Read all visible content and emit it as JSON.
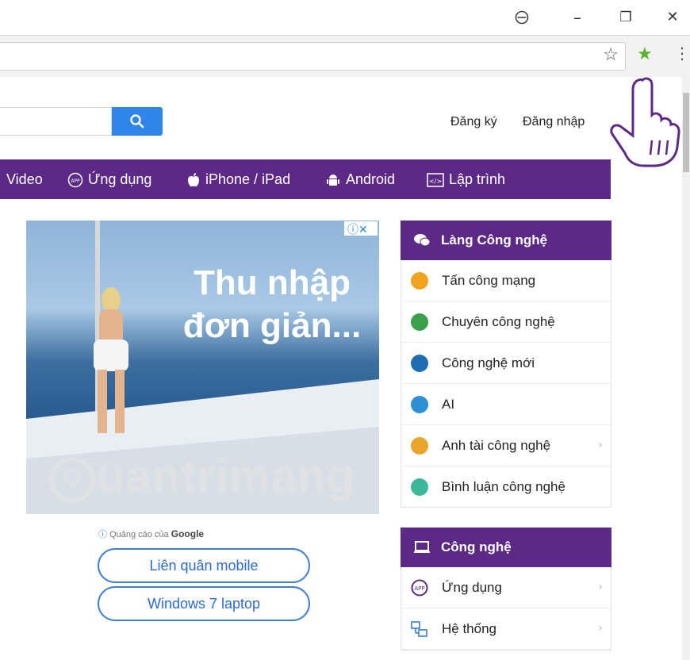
{
  "browser": {
    "profile_icon": "account-icon",
    "minimize": "–",
    "restore": "❐",
    "close": "✕",
    "bookmark_icon": "☆",
    "extension_icon": "★",
    "menu_icon": "⋮"
  },
  "header": {
    "register": "Đăng ký",
    "login": "Đăng nhập",
    "search_placeholder": ""
  },
  "nav": {
    "items": [
      {
        "label": "Video"
      },
      {
        "label": "Ứng dụng",
        "icon": "app-icon"
      },
      {
        "label": "iPhone / iPad",
        "icon": "apple-icon"
      },
      {
        "label": "Android",
        "icon": "android-icon"
      },
      {
        "label": "Lập trình",
        "icon": "code-icon"
      }
    ]
  },
  "ad": {
    "headline_line1": "Thu nhập",
    "headline_line2": "đơn giản...",
    "choices": "ⓘ✕",
    "credit_prefix": "Quảng cáo của",
    "credit_brand": "Google",
    "links": [
      "Liên quân mobile",
      "Windows 7 laptop"
    ],
    "watermark": "uantrimang"
  },
  "sidebar": {
    "section1_title": "Làng Công nghệ",
    "section1_items": [
      {
        "label": "Tấn công mạng",
        "color": "#f0a31d"
      },
      {
        "label": "Chuyên công nghệ",
        "color": "#3aa14a"
      },
      {
        "label": "Công nghệ mới",
        "color": "#1f6eb4"
      },
      {
        "label": "AI",
        "color": "#2d8fd6"
      },
      {
        "label": "Anh tài công nghệ",
        "color": "#e8a72c"
      },
      {
        "label": "Bình luận công nghệ",
        "color": "#3bb89a"
      }
    ],
    "section2_title": "Công nghệ",
    "section2_items": [
      {
        "label": "Ứng dụng",
        "color": "#5c2a86"
      },
      {
        "label": "Hệ thống",
        "color": "#3a7bd5"
      }
    ]
  },
  "colors": {
    "brand_purple": "#5c2a86",
    "search_blue": "#2f86e8"
  }
}
